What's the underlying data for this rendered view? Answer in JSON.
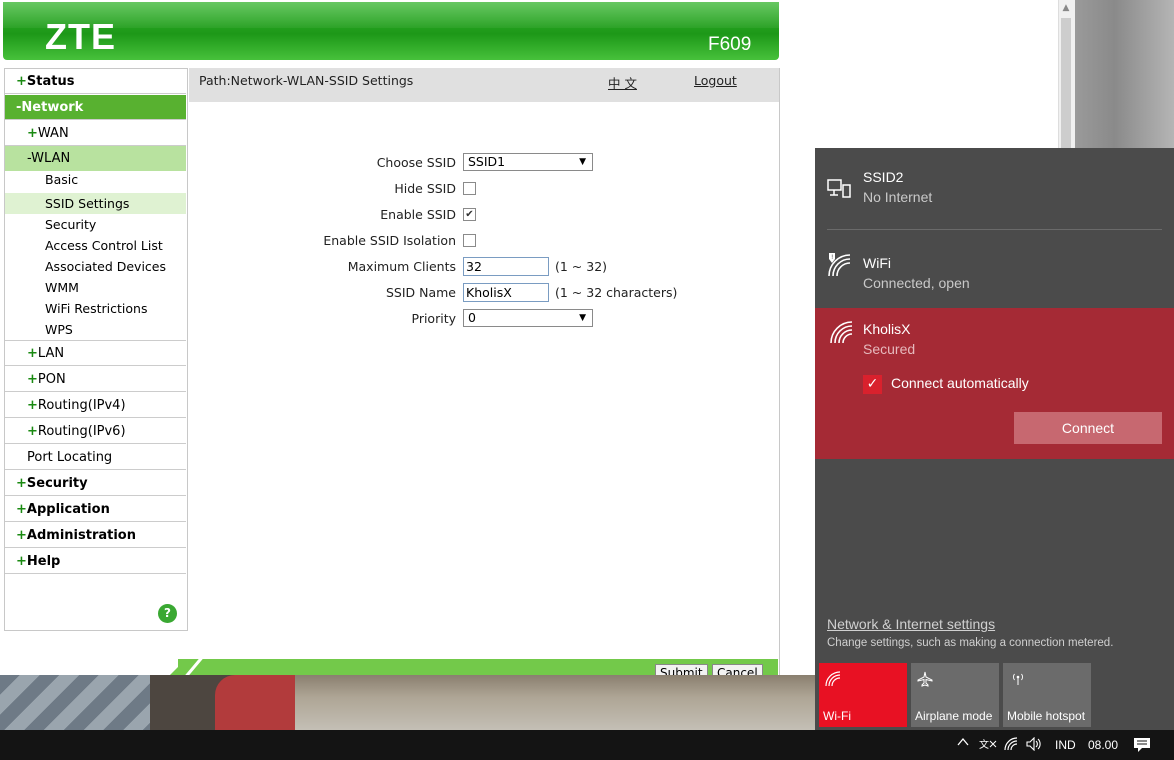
{
  "router": {
    "brand": "ZTE",
    "model": "F609",
    "path": "Path:Network-WLAN-SSID Settings",
    "language_link": "中 文",
    "logout_link": "Logout",
    "help_icon": "?",
    "nav": {
      "status": "Status",
      "network": "Network",
      "wan": "WAN",
      "wlan": "WLAN",
      "basic": "Basic",
      "ssid_settings": "SSID Settings",
      "security_sub": "Security",
      "acl": "Access Control List",
      "associated": "Associated Devices",
      "wmm": "WMM",
      "wifi_restrictions": "WiFi Restrictions",
      "wps": "WPS",
      "lan": "LAN",
      "pon": "PON",
      "routing4": "Routing(IPv4)",
      "routing6": "Routing(IPv6)",
      "port_locating": "Port Locating",
      "security": "Security",
      "application": "Application",
      "administration": "Administration",
      "help": "Help",
      "plus": "+",
      "minus": "-"
    },
    "form": {
      "choose_ssid_label": "Choose SSID",
      "choose_ssid_value": "SSID1",
      "hide_ssid_label": "Hide SSID",
      "hide_ssid_checked": false,
      "enable_ssid_label": "Enable SSID",
      "enable_ssid_checked": true,
      "isolation_label": "Enable SSID Isolation",
      "isolation_checked": false,
      "max_clients_label": "Maximum Clients",
      "max_clients_value": "32",
      "max_clients_hint": "(1 ~ 32)",
      "ssid_name_label": "SSID Name",
      "ssid_name_value": "KholisX",
      "ssid_name_hint": "(1 ~ 32 characters)",
      "priority_label": "Priority",
      "priority_value": "0"
    },
    "buttons": {
      "submit": "Submit",
      "cancel": "Cancel"
    }
  },
  "flyout": {
    "networks": [
      {
        "name": "SSID2",
        "status": "No Internet",
        "icon": "ethernet-monitor-icon"
      },
      {
        "name": "WiFi",
        "status": "Connected, open",
        "icon": "wifi-shield-icon"
      },
      {
        "name": "KholisX",
        "status": "Secured",
        "icon": "wifi-icon"
      }
    ],
    "connect_automatically": "Connect automatically",
    "connect_button": "Connect",
    "settings_link": "Network & Internet settings",
    "settings_desc": "Change settings, such as making a connection metered.",
    "tiles": [
      {
        "label": "Wi-Fi",
        "active": true
      },
      {
        "label": "Airplane mode",
        "active": false
      },
      {
        "label": "Mobile hotspot",
        "active": false
      }
    ],
    "accent_color": "#e81123"
  },
  "taskbar": {
    "language": "IND",
    "time": "08.00"
  }
}
